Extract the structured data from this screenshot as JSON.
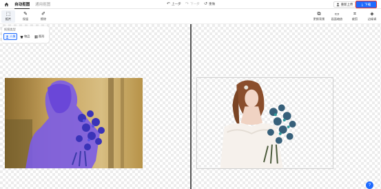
{
  "header": {
    "tabs": [
      {
        "label": "自动抠图",
        "active": true
      },
      {
        "label": "通用抠图",
        "active": false
      }
    ],
    "history": {
      "undo": "上一步",
      "redo": "下一步",
      "reset": "重做"
    },
    "reupload_label": "重新上传",
    "download_label": "下载",
    "accent_color": "#1f6bff"
  },
  "toolbar": {
    "left_tools": [
      {
        "label": "抠片",
        "icon": "select-icon"
      },
      {
        "label": "保留",
        "icon": "brush-keep-icon"
      },
      {
        "label": "擦除",
        "icon": "brush-erase-icon"
      }
    ],
    "right_tools": [
      {
        "label": "更换背景",
        "icon": "background-icon"
      },
      {
        "label": "画面缩放",
        "icon": "zoom-icon"
      },
      {
        "label": "裁剪",
        "icon": "crop-icon"
      },
      {
        "label": "边缘调",
        "icon": "edge-icon"
      }
    ]
  },
  "panel": {
    "title": "抠图类型",
    "options": [
      {
        "label": "人像",
        "icon": "person-icon",
        "selected": true
      },
      {
        "label": "物品",
        "icon": "object-icon",
        "selected": false
      },
      {
        "label": "图形",
        "icon": "graphic-icon",
        "selected": false
      }
    ]
  },
  "help_label": "?"
}
